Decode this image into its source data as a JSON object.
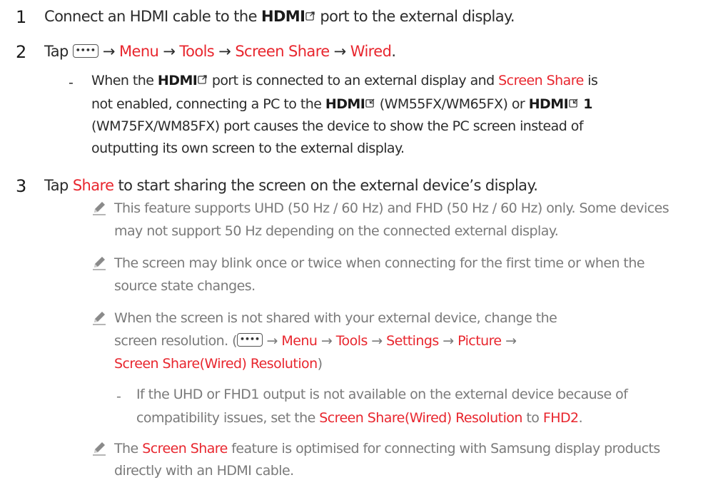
{
  "step1": {
    "num": "1",
    "pre": "Connect an HDMI cable to the ",
    "hdmi": "HDMI",
    "post": " port to the external display."
  },
  "step2": {
    "num": "2",
    "tap": "Tap",
    "btn": "••••",
    "arrow": "→",
    "menu": "Menu",
    "tools": "Tools",
    "screen_share": "Screen Share",
    "wired": "Wired",
    "period": "."
  },
  "note2": {
    "dash": "-",
    "l1_pre": "When the ",
    "hdmi": "HDMI",
    "l1_mid": " port is connected to an external display and ",
    "l1_red": "Screen Share",
    "l1_post": " is",
    "l2_pre": "not enabled, connecting a PC to the ",
    "l2_mid": " (WM55FX/WM65FX) or ",
    "l2_one": " 1",
    "l3": "(WM75FX/WM85FX) port causes the device to show the PC screen instead of",
    "l4": "outputting its own screen to the external display."
  },
  "step3": {
    "num": "3",
    "tap": "Tap ",
    "share": "Share",
    "post": " to start sharing the screen on the external device’s display."
  },
  "notes": {
    "n1_l1": "This feature supports UHD (50 Hz / 60 Hz) and FHD (50 Hz / 60 Hz) only. Some devices",
    "n1_l2": "may not support 50 Hz depending on the connected external display.",
    "n2_l1": "The screen may blink once or twice when connecting for the first time or when the",
    "n2_l2": "source state changes.",
    "n3_l1": "When the screen is not shared with your external device, change the",
    "n3_l2_pre": "screen resolution. (",
    "menu": "Menu",
    "tools": "Tools",
    "settings": "Settings",
    "picture": "Picture",
    "n3_l3_red": "Screen Share(Wired) Resolution",
    "n3_l3_post": ")",
    "sub_dash": "-",
    "sub_l1": "If the UHD or FHD1 output is not available on the external device because of",
    "sub_l2_pre": "compatibility issues, set the ",
    "sub_l2_red": "Screen Share(Wired) Resolution",
    "sub_l2_mid": " to ",
    "sub_l2_red2": "FHD2",
    "sub_l2_post": ".",
    "n4_l1_pre": "The ",
    "n4_l1_red": "Screen Share",
    "n4_l1_post": " feature is optimised for connecting with Samsung display products",
    "n4_l2": "directly with an HDMI cable."
  },
  "colors": {
    "accent": "#e8262e",
    "note_text": "#7a7a7a",
    "body_text": "#2b2b2b"
  }
}
